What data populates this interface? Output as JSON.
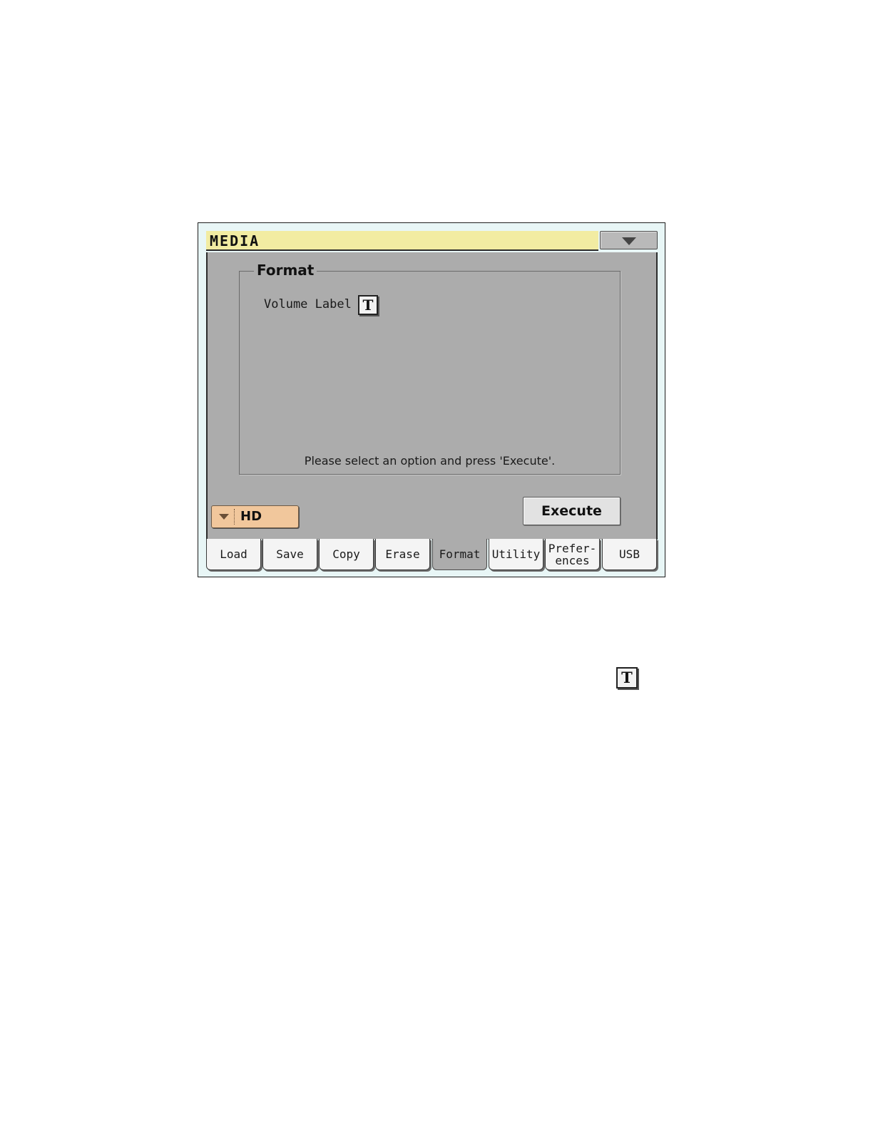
{
  "window": {
    "title": "MEDIA",
    "menu_icon": "triangle-down-icon"
  },
  "format_group": {
    "title": "Format",
    "volume_label": "Volume Label",
    "text_edit_icon_glyph": "T",
    "prompt": "Please select an option and press 'Execute'."
  },
  "device_selector": {
    "selected": "HD",
    "icon": "dropdown-arrow-icon"
  },
  "execute_button": {
    "label": "Execute"
  },
  "tabs": [
    {
      "label": "Load",
      "active": false
    },
    {
      "label": "Save",
      "active": false
    },
    {
      "label": "Copy",
      "active": false
    },
    {
      "label": "Erase",
      "active": false
    },
    {
      "label": "Format",
      "active": true
    },
    {
      "label": "Utility",
      "active": false
    },
    {
      "label": "Prefer-\nences",
      "active": false
    },
    {
      "label": "USB",
      "active": false
    }
  ],
  "standalone_icon": {
    "glyph": "T",
    "name": "text-edit-icon"
  },
  "colors": {
    "titlebar": "#f2eca2",
    "panel": "#acacac",
    "screen_bg": "#e8f6f6",
    "device_selector": "#f1c79c",
    "execute_button": "#e2e2e2"
  }
}
